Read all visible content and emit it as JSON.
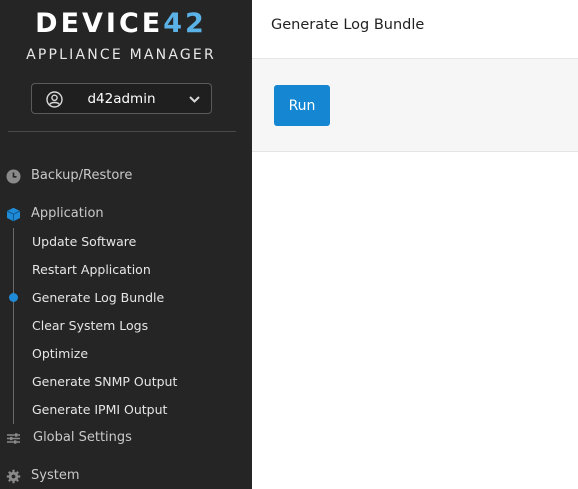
{
  "sidebar": {
    "logo": {
      "main": "DEVICE",
      "accent": "42"
    },
    "subtitle": "APPLIANCE MANAGER",
    "user": {
      "name": "d42admin"
    },
    "nav": [
      {
        "label": "Backup/Restore",
        "icon": "clock-icon"
      },
      {
        "label": "Application",
        "icon": "cube-icon",
        "accent_color": "#1f8ad6"
      },
      {
        "label": "Global Settings",
        "icon": "sliders-icon"
      },
      {
        "label": "System",
        "icon": "gear-icon"
      }
    ],
    "application_items": [
      {
        "label": "Update Software"
      },
      {
        "label": "Restart Application"
      },
      {
        "label": "Generate Log Bundle",
        "active": true
      },
      {
        "label": "Clear System Logs"
      },
      {
        "label": "Optimize"
      },
      {
        "label": "Generate SNMP Output"
      },
      {
        "label": "Generate IPMI Output"
      }
    ]
  },
  "header": {
    "title": "Generate Log Bundle"
  },
  "main": {
    "run_label": "Run"
  },
  "colors": {
    "accent": "#1586d2",
    "sidebar_bg": "#252525",
    "logo_accent": "#5bb2e6"
  }
}
